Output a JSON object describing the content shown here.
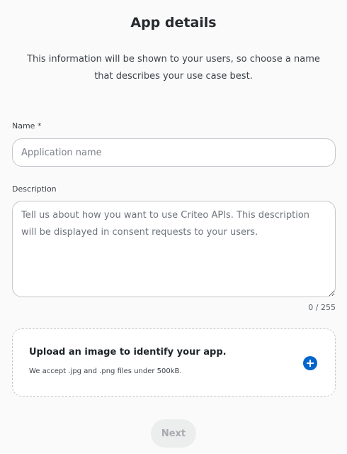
{
  "header": {
    "title": "App details",
    "subtitle": "This information will be shown to your users, so choose a name that describes your use case best."
  },
  "form": {
    "name": {
      "label": "Name *",
      "placeholder": "Application name",
      "value": ""
    },
    "description": {
      "label": "Description",
      "placeholder": "Tell us about how you want to use Criteo APIs. This description will be displayed in consent requests to your users.",
      "value": "",
      "counter": "0 / 255"
    },
    "upload": {
      "title": "Upload an image to identify your app.",
      "hint": "We accept .jpg and .png files under 500kB.",
      "icon": "plus-circle-icon"
    }
  },
  "actions": {
    "next_label": "Next",
    "next_enabled": false
  },
  "colors": {
    "accent": "#0066cc",
    "border": "#c4c7cc",
    "background": "#fafafa",
    "disabled_button_bg": "#eceded",
    "disabled_button_text": "#a7aaae"
  }
}
